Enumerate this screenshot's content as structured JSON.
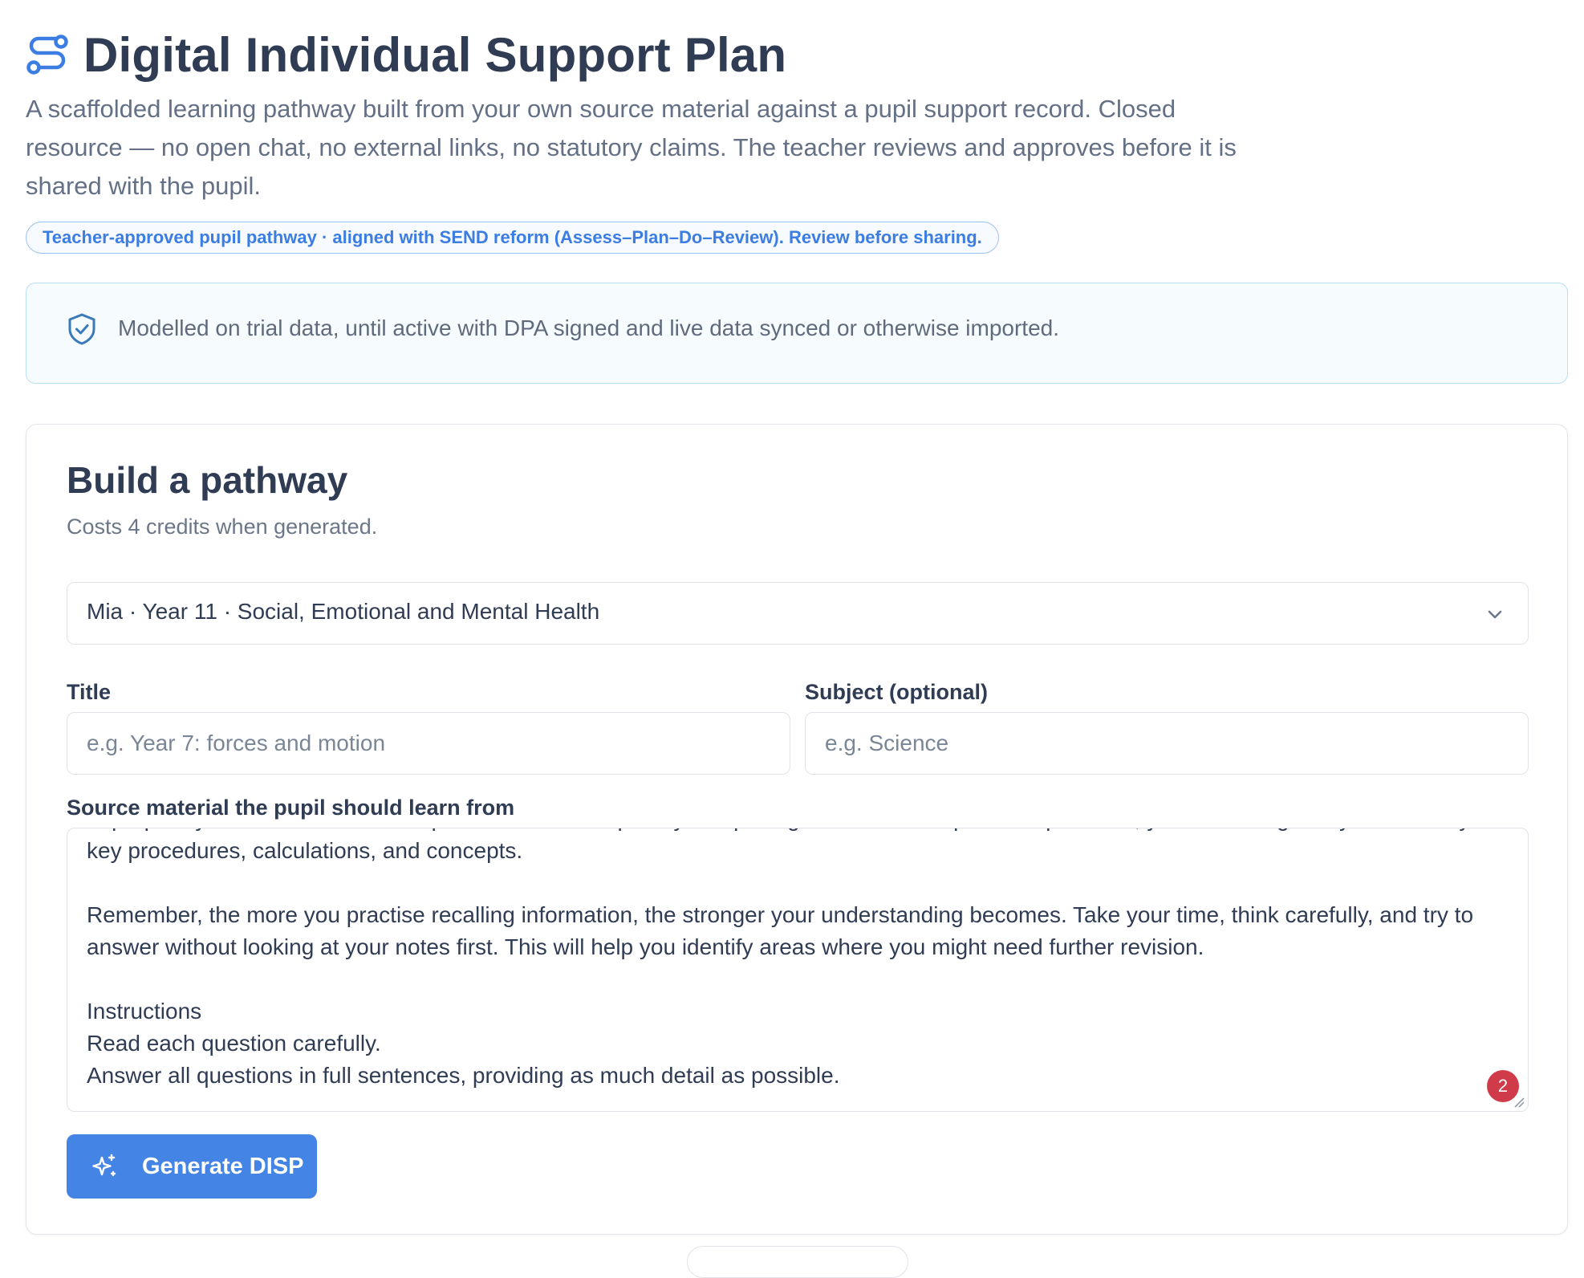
{
  "header": {
    "title": "Digital Individual Support Plan",
    "description": "A scaffolded learning pathway built from your own source material against a pupil support record. Closed resource — no open chat, no external links, no statutory claims. The teacher reviews and approves before it is shared with the pupil.",
    "pill": "Teacher-approved pupil pathway · aligned with SEND reform (Assess–Plan–Do–Review). Review before sharing.",
    "icon": "route-icon"
  },
  "notice": {
    "icon": "shield-check-icon",
    "text": "Modelled on trial data, until active with DPA signed and live data synced or otherwise imported."
  },
  "builder": {
    "title": "Build a pathway",
    "subtitle": "Costs 4 credits when generated.",
    "pupil_select": {
      "value": "Mia · Year 11 · Social, Emotional and Mental Health",
      "icon": "chevron-down-icon"
    },
    "title_field": {
      "label": "Title",
      "placeholder": "e.g. Year 7: forces and motion",
      "value": ""
    },
    "subject_field": {
      "label": "Subject (optional)",
      "placeholder": "e.g. Science",
      "value": ""
    },
    "source_field": {
      "label": "Source material the pupil should learn from",
      "value": "to prepare you for common exam questions on this topic. By completing these retrieval practice questions, you will strengthen your memory of key procedures, calculations, and concepts.\n\nRemember, the more you practise recalling information, the stronger your understanding becomes. Take your time, think carefully, and try to answer without looking at your notes first. This will help you identify areas where you might need further revision.\n\nInstructions\nRead each question carefully.\nAnswer all questions in full sentences, providing as much detail as possible.",
      "badge_count": "2"
    },
    "generate_button": {
      "label": "Generate DISP",
      "icon": "sparkles-icon"
    }
  },
  "colors": {
    "accent": "#4484e4",
    "title": "#2f3c53",
    "badge": "#d03b4a",
    "notice_border": "#b8e0f3"
  }
}
